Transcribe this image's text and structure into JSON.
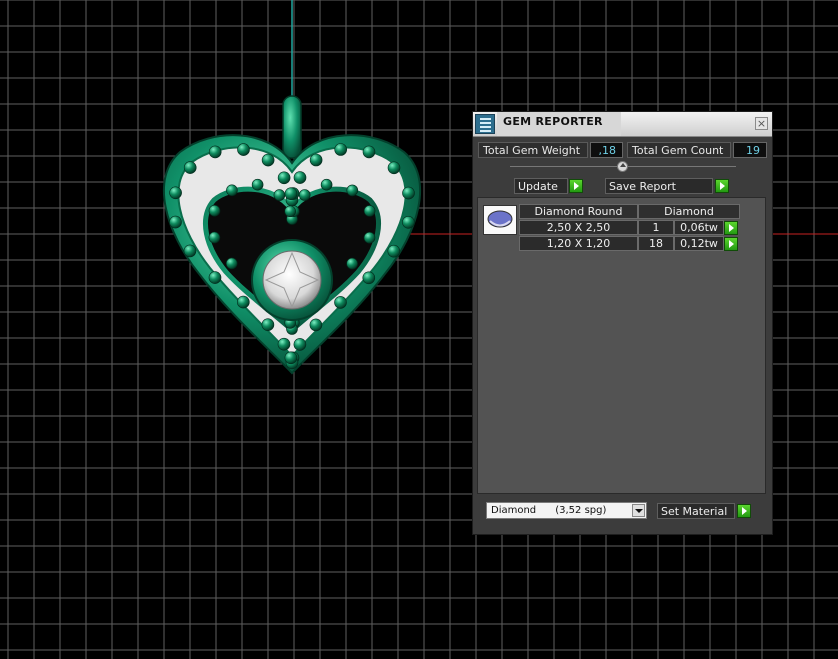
{
  "window": {
    "title": "GEM REPORTER",
    "close_glyph": "×"
  },
  "summary": {
    "weight_label": "Total Gem Weight",
    "weight_value": ",18",
    "count_label": "Total Gem Count",
    "count_value": "19"
  },
  "buttons": {
    "update": "Update",
    "save_report": "Save Report",
    "set_material": "Set Material"
  },
  "table": {
    "headers": [
      "Diamond Round",
      "Diamond"
    ],
    "rows": [
      {
        "size": "2,50 X 2,50",
        "count": "1",
        "weight": "0,06tw"
      },
      {
        "size": "1,20 X 1,20",
        "count": "18",
        "weight": "0,12tw"
      }
    ]
  },
  "material_select": {
    "selected": "Diamond      (3,52 spg)"
  },
  "colors": {
    "metal": "#0e8b63",
    "grid": "#6a6a6a",
    "axis_red": "#c62222",
    "axis_cyan": "#20a8a0",
    "accent_green": "#3ec41e",
    "value_text": "#6fd0e6"
  },
  "icons": [
    "gem-reporter-icon",
    "close-icon",
    "slider-icon",
    "gem-thumbnail-icon",
    "play-arrow-icon",
    "dropdown-arrow-icon"
  ]
}
